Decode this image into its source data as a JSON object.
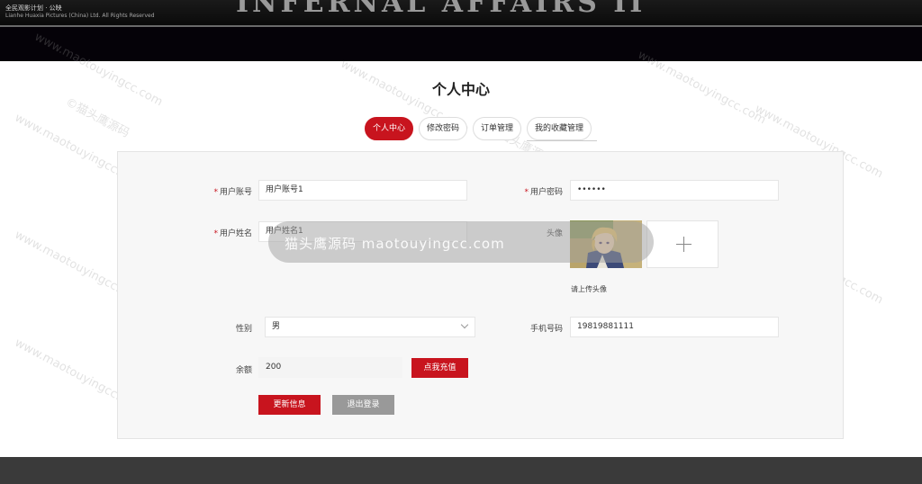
{
  "banner": {
    "line1": "全民观影计划 · 公映",
    "line2": "Lianhe Huaxia Pictures (China) Ltd. All Rights Reserved",
    "title": "INFERNAL AFFAIRS II"
  },
  "page": {
    "title": "个人中心"
  },
  "tabs": [
    {
      "label": "个人中心",
      "active": true
    },
    {
      "label": "修改密码",
      "active": false
    },
    {
      "label": "订单管理",
      "active": false
    },
    {
      "label": "我的收藏管理",
      "active": false
    }
  ],
  "form": {
    "account": {
      "label": "用户账号",
      "required_mark": "*",
      "value": "用户账号1"
    },
    "password": {
      "label": "用户密码",
      "required_mark": "*",
      "value": "••••••"
    },
    "name": {
      "label": "用户姓名",
      "required_mark": "*",
      "value": "用户姓名1"
    },
    "avatar": {
      "label": "头像",
      "upload_tip": "请上传头像",
      "plus": "+"
    },
    "gender": {
      "label": "性别",
      "value": "男"
    },
    "phone": {
      "label": "手机号码",
      "value": "19819881111"
    },
    "balance": {
      "label": "余额",
      "value": "200"
    }
  },
  "buttons": {
    "recharge": "点我充值",
    "update": "更新信息",
    "logout": "退出登录"
  },
  "watermark": {
    "pill_text": "猫头鹰源码 maotouyingcc.com",
    "line_a": "©猫头鹰源码",
    "line_b": "www.maotouyingcc.com"
  },
  "colors": {
    "accent": "#c8141e",
    "panel_bg": "#f7f7f7",
    "footer_bg": "#3a3a3a"
  }
}
